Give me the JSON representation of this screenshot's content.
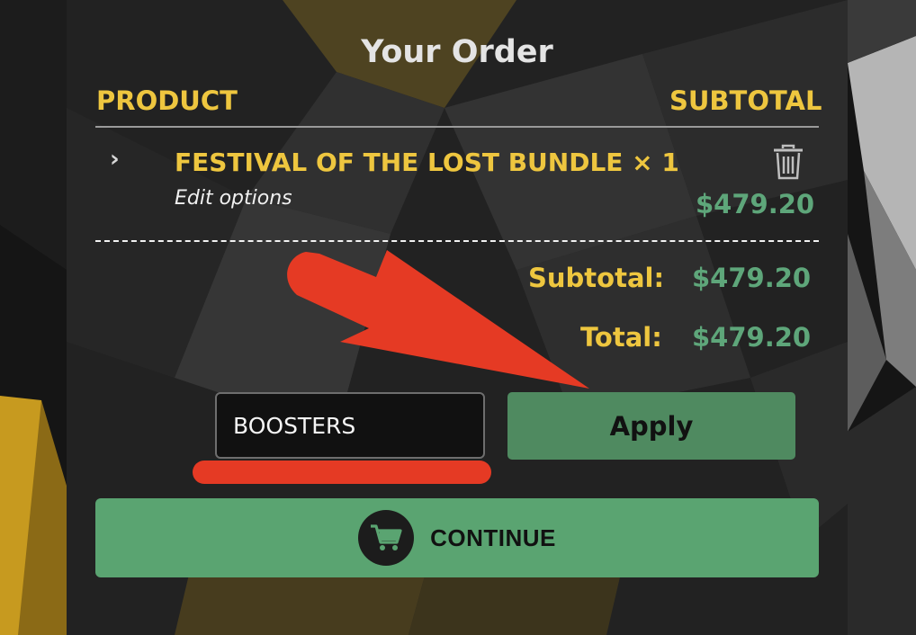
{
  "order": {
    "title": "Your Order",
    "col_product": "PRODUCT",
    "col_subtotal": "SUBTOTAL",
    "item": {
      "name": "FESTIVAL OF THE LOST BUNDLE × 1",
      "edit_label": "Edit options",
      "price": "$479.20",
      "expand_icon": "chevron-right-icon",
      "remove_icon": "trash-icon"
    },
    "subtotal_label": "Subtotal:",
    "subtotal_value": "$479.20",
    "total_label": "Total:",
    "total_value": "$479.20"
  },
  "coupon": {
    "value": "BOOSTERS",
    "apply_label": "Apply"
  },
  "continue": {
    "label": "CONTINUE",
    "icon": "shopping-cart-icon"
  },
  "colors": {
    "accent_yellow": "#eec63f",
    "price_green": "#5ea67a",
    "button_green": "#5aa471",
    "apply_green": "#4f8a60",
    "annotation_red": "#e53a24"
  }
}
